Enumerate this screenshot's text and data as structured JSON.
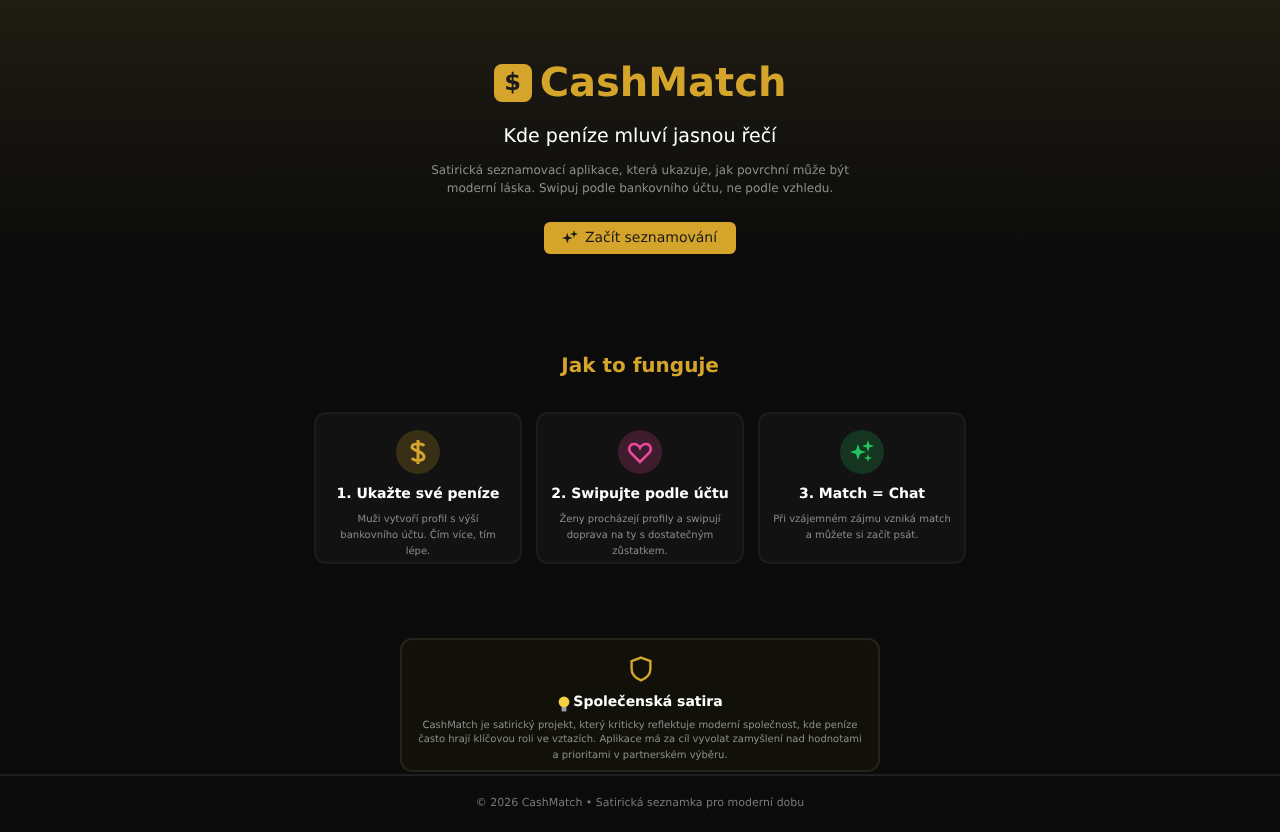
{
  "hero": {
    "logo_symbol": "$",
    "brand": "CashMatch",
    "tagline": "Kde peníze mluví jasnou řečí",
    "description": "Satirická seznamovací aplikace, která ukazuje, jak povrchní může být moderní láska. Swipuj podle bankovního účtu, ne podle vzhledu.",
    "cta": "Začít seznamování"
  },
  "how": {
    "title": "Jak to funguje",
    "steps": [
      {
        "kind": "money",
        "color": "#d4a52a",
        "title": "1. Ukažte své peníze",
        "text": "Muži vytvoří profil s výší bankovního účtu. Čím více, tím lépe."
      },
      {
        "kind": "heart",
        "color": "#ec4899",
        "title": "2. Swipujte podle účtu",
        "text": "Ženy procházejí profily a swipují doprava na ty s dostatečným zůstatkem."
      },
      {
        "kind": "sparkle",
        "color": "#22c55e",
        "title": "3. Match = Chat",
        "text": "Při vzájemném zájmu vzniká match a můžete si začít psát."
      }
    ]
  },
  "satire": {
    "title": "Společenská satira",
    "text": "CashMatch je satirický projekt, který kriticky reflektuje moderní společnost, kde peníze často hrají klíčovou roli ve vztazích. Aplikace má za cíl vyvolat zamyšlení nad hodnotami a prioritami v partnerském výběru."
  },
  "footer": "© 2026 CashMatch • Satirická seznamka pro moderní dobu"
}
